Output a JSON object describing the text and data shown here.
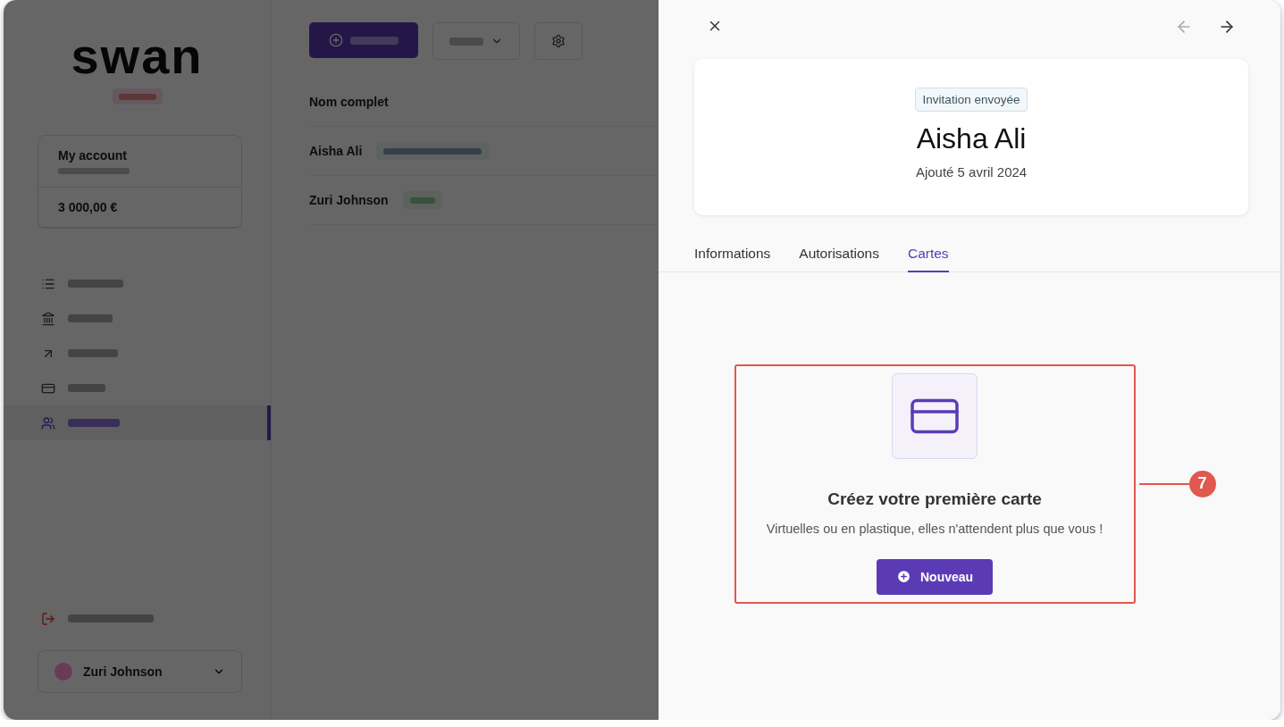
{
  "background": {
    "logo": "swan",
    "account": {
      "name": "My account",
      "balance": "3 000,00 €"
    },
    "nav": [
      {
        "kind": "list",
        "selected": false
      },
      {
        "kind": "bank",
        "selected": false
      },
      {
        "kind": "arrow",
        "selected": false
      },
      {
        "kind": "card",
        "selected": false
      },
      {
        "kind": "people",
        "selected": true
      }
    ],
    "user": "Zuri Johnson",
    "table": {
      "column": "Nom complet",
      "rows": [
        {
          "name": "Aisha Ali",
          "kind": "invited"
        },
        {
          "name": "Zuri Johnson",
          "kind": "active"
        }
      ]
    }
  },
  "drawer": {
    "status": "Invitation envoyée",
    "name": "Aisha Ali",
    "added": "Ajouté 5 avril 2024",
    "tabs": [
      {
        "label": "Informations",
        "selected": false
      },
      {
        "label": "Autorisations",
        "selected": false
      },
      {
        "label": "Cartes",
        "selected": true
      }
    ],
    "empty_state": {
      "title": "Créez votre première carte",
      "text": "Virtuelles ou en plastique, elles n'attendent plus que vous !",
      "button": "Nouveau"
    },
    "callout": "7"
  }
}
